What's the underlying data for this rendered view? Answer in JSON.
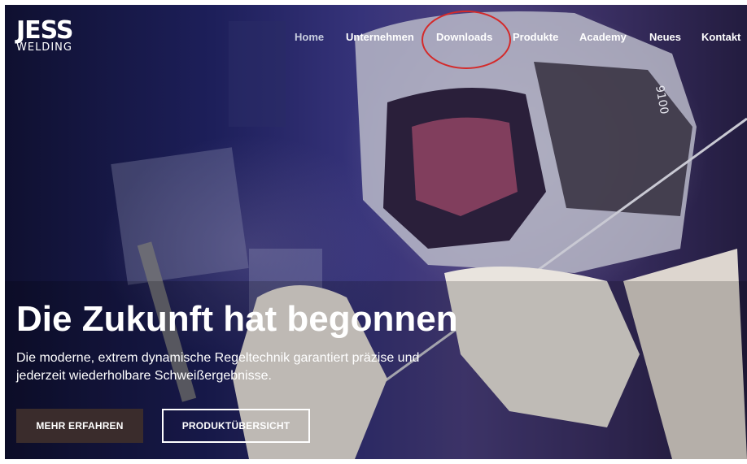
{
  "brand": {
    "name": "JESS",
    "sub": "WELDING"
  },
  "nav": {
    "items": [
      {
        "label": "Home"
      },
      {
        "label": "Unternehmen"
      },
      {
        "label": "Downloads"
      },
      {
        "label": "Produkte"
      },
      {
        "label": "Academy"
      },
      {
        "label": "Neues"
      },
      {
        "label": "Kontakt"
      }
    ],
    "active": "Home",
    "highlighted": "Downloads"
  },
  "hero": {
    "headline": "Die Zukunft hat begonnen",
    "subline": "Die moderne, extrem dynamische Regeltechnik garantiert präzise und jederzeit wiederholbare Schweißergebnisse.",
    "primary_button": "MEHR ERFAHREN",
    "secondary_button": "PRODUKTÜBERSICHT",
    "helmet_text": "9100",
    "overlay_color": "#1d1f5a",
    "highlight_color": "#d42a2a"
  }
}
